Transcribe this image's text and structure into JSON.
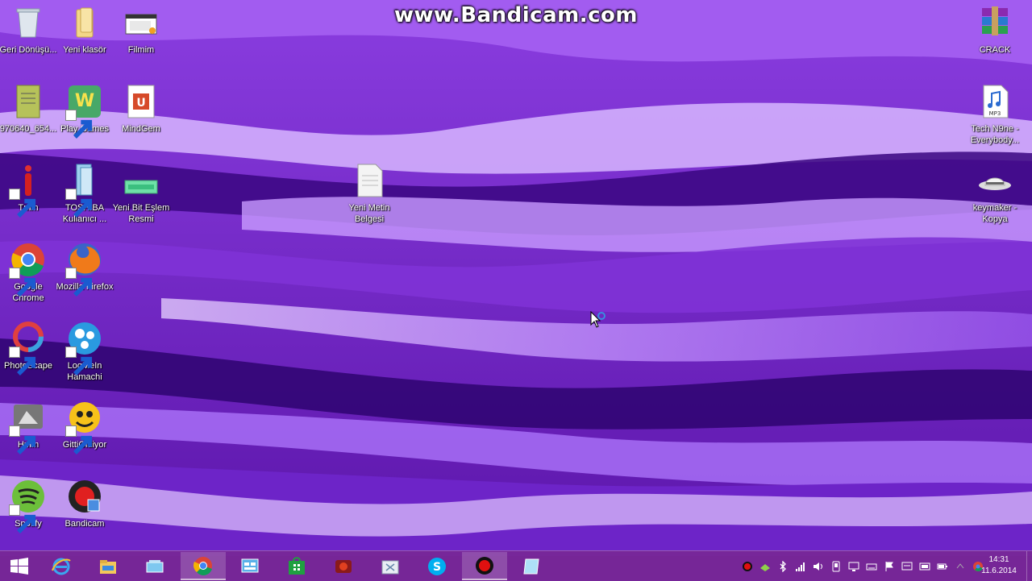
{
  "watermark": "www.Bandicam.com",
  "desktop_icons": [
    {
      "name": "recycle-bin-icon",
      "label": "Geri Dönüşü..."
    },
    {
      "name": "folder-icon",
      "label": "Yeni klasör"
    },
    {
      "name": "movie-icon",
      "label": "Filmim"
    },
    {
      "name": "green-document-icon",
      "label": "970640_654..."
    },
    {
      "name": "play-games-icon",
      "label": "Play Games"
    },
    {
      "name": "mindgem-icon",
      "label": "MindGem"
    },
    {
      "name": "tmm-icon",
      "label": "Tmm"
    },
    {
      "name": "toshiba-icon",
      "label": "TOSHIBA Kullanıcı ..."
    },
    {
      "name": "bitmap-icon",
      "label": "Yeni Bit Eşlem Resmi"
    },
    {
      "name": "text-document-icon",
      "label": "Yeni Metin Belgesi"
    },
    {
      "name": "chrome-icon",
      "label": "Google Chrome"
    },
    {
      "name": "firefox-icon",
      "label": "Mozilla Firefox"
    },
    {
      "name": "photoscape-icon",
      "label": "PhotoScape"
    },
    {
      "name": "hamachi-icon",
      "label": "LogMeIn Hamachi"
    },
    {
      "name": "hmm-icon",
      "label": "Hmm"
    },
    {
      "name": "gittigidiyor-icon",
      "label": "GittiGidiyor"
    },
    {
      "name": "spotify-icon",
      "label": "Spotify"
    },
    {
      "name": "bandicam-icon",
      "label": "Bandicam"
    },
    {
      "name": "winrar-icon",
      "label": "CRACK"
    },
    {
      "name": "mp3-icon",
      "label": "Tech N9ne - Everybody..."
    },
    {
      "name": "keymaker-icon",
      "label": "keymaker - Kopya"
    }
  ],
  "taskbar": {
    "buttons": [
      "start-icon",
      "internet-explorer-icon",
      "file-explorer-icon",
      "folder-app-icon",
      "chrome-icon",
      "control-panel-icon",
      "store-icon",
      "mindgem-icon",
      "recycle-bin-icon",
      "skype-icon",
      "bandicam-record-icon",
      "notepad-icon"
    ],
    "tray": [
      "record-tray-icon",
      "network-tray-icon",
      "bluetooth-icon",
      "signal-icon",
      "volume-icon",
      "device-icon",
      "display-icon",
      "keyboard-icon",
      "flag-icon",
      "action-center-icon",
      "wifi-icon",
      "battery-icon",
      "hidden-icon",
      "chrome-tray-icon"
    ],
    "time": "14:31",
    "date": "11.6.2014"
  }
}
